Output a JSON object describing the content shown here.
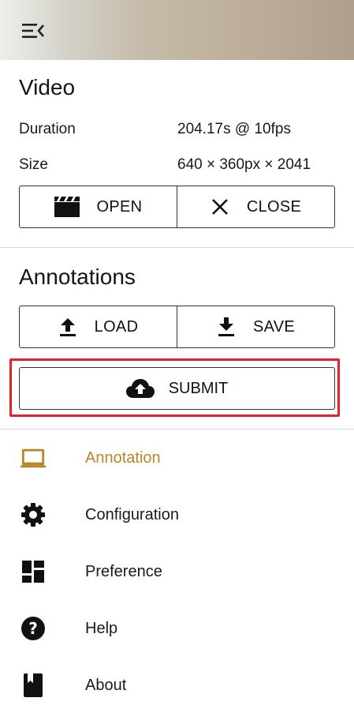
{
  "colors": {
    "accent": "#b8862a",
    "highlight": "#e3202e"
  },
  "header": {
    "menu_icon": "menu-collapse-icon"
  },
  "video": {
    "title": "Video",
    "duration_label": "Duration",
    "duration_value": "204.17s @ 10fps",
    "size_label": "Size",
    "size_value": "640 × 360px × 2041",
    "open_label": "OPEN",
    "close_label": "CLOSE"
  },
  "annotations": {
    "title": "Annotations",
    "load_label": "LOAD",
    "save_label": "SAVE",
    "submit_label": "SUBMIT"
  },
  "nav": {
    "items": [
      {
        "label": "Annotation",
        "icon": "laptop-icon",
        "active": true
      },
      {
        "label": "Configuration",
        "icon": "gear-icon",
        "active": false
      },
      {
        "label": "Preference",
        "icon": "dashboard-icon",
        "active": false
      },
      {
        "label": "Help",
        "icon": "help-icon",
        "active": false
      },
      {
        "label": "About",
        "icon": "book-icon",
        "active": false
      }
    ]
  }
}
